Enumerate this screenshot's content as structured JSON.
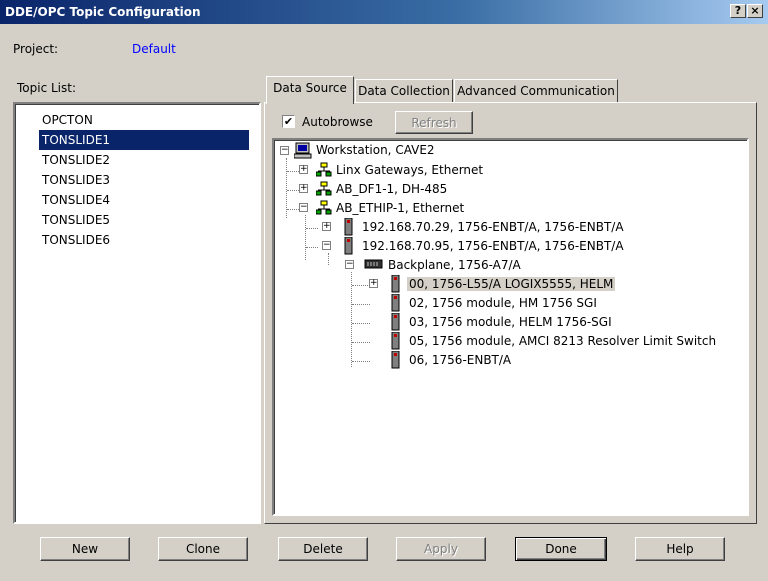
{
  "window": {
    "title": "DDE/OPC Topic Configuration",
    "help_btn": "?",
    "close_btn": "×"
  },
  "project": {
    "label": "Project:",
    "value": "Default"
  },
  "topic_list": {
    "label": "Topic List:",
    "items": [
      "OPCTON",
      "TONSLIDE1",
      "TONSLIDE2",
      "TONSLIDE3",
      "TONSLIDE4",
      "TONSLIDE5",
      "TONSLIDE6"
    ],
    "selected": "TONSLIDE1"
  },
  "tabs": [
    "Data Source",
    "Data Collection",
    "Advanced Communication"
  ],
  "active_tab": "Data Source",
  "autobrowse": {
    "label": "Autobrowse",
    "checked": true,
    "check_mark": "✔"
  },
  "refresh_label": "Refresh",
  "tree": {
    "expand_plus": "+",
    "expand_minus": "−",
    "nodes": [
      {
        "label": "Workstation, CAVE2",
        "icon": "workstation-icon",
        "expander": "minus"
      },
      {
        "label": "Linx Gateways, Ethernet",
        "icon": "network-icon",
        "expander": "plus"
      },
      {
        "label": "AB_DF1-1, DH-485",
        "icon": "network-icon",
        "expander": "plus"
      },
      {
        "label": "AB_ETHIP-1, Ethernet",
        "icon": "network-icon",
        "expander": "minus"
      },
      {
        "label": "192.168.70.29, 1756-ENBT/A, 1756-ENBT/A",
        "icon": "module-icon",
        "expander": "plus"
      },
      {
        "label": "192.168.70.95, 1756-ENBT/A, 1756-ENBT/A",
        "icon": "module-icon",
        "expander": "minus"
      },
      {
        "label": "Backplane, 1756-A7/A",
        "icon": "backplane-icon",
        "expander": "minus"
      },
      {
        "label": "00, 1756-L55/A LOGIX5555, HELM",
        "icon": "module-icon",
        "expander": "plus",
        "highlighted": true
      },
      {
        "label": "02, 1756 module, HM 1756 SGI",
        "icon": "module-icon"
      },
      {
        "label": "03, 1756 module, HELM 1756-SGI",
        "icon": "module-icon"
      },
      {
        "label": "05, 1756 module, AMCI 8213 Resolver Limit Switch",
        "icon": "module-icon"
      },
      {
        "label": "06, 1756-ENBT/A",
        "icon": "module-icon"
      }
    ]
  },
  "buttons": {
    "new": "New",
    "clone": "Clone",
    "delete": "Delete",
    "apply": "Apply",
    "done": "Done",
    "help": "Help"
  }
}
